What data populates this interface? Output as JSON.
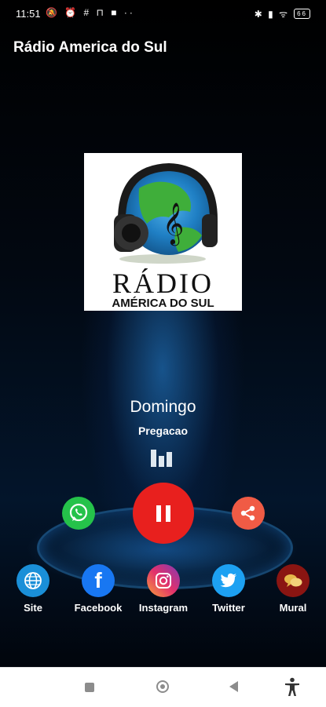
{
  "status_bar": {
    "time": "11:51",
    "left_icons": "🔕 ⏰ # ⊓ ■ ··",
    "right_icons": "✱ ▮ ᯤ",
    "battery": "66"
  },
  "app": {
    "title": "Rádio America do Sul"
  },
  "logo": {
    "line1": "RÁDIO",
    "line2": "AMÉRICA DO SUL"
  },
  "now_playing": {
    "title": "Domingo",
    "subtitle": "Pregacao"
  },
  "player": {
    "state": "playing"
  },
  "social": [
    {
      "label": "Site",
      "icon": "globe-icon"
    },
    {
      "label": "Facebook",
      "icon": "facebook-icon",
      "glyph": "f"
    },
    {
      "label": "Instagram",
      "icon": "instagram-icon"
    },
    {
      "label": "Twitter",
      "icon": "twitter-icon"
    },
    {
      "label": "Mural",
      "icon": "chat-bubbles-icon"
    }
  ],
  "colors": {
    "whatsapp": "#25c24a",
    "play": "#e8201e",
    "share": "#f05b45"
  }
}
